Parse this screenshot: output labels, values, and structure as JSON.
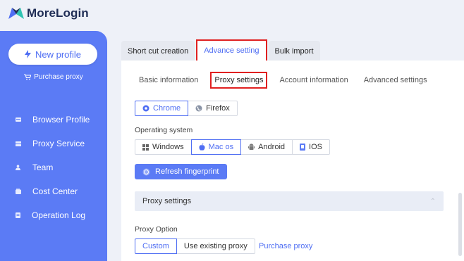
{
  "app": {
    "name": "MoreLogin"
  },
  "sidebar": {
    "new_profile_label": "New profile",
    "purchase_label": "Purchase proxy",
    "items": [
      {
        "label": "Browser Profile",
        "icon": "browser-icon"
      },
      {
        "label": "Proxy Service",
        "icon": "proxy-icon"
      },
      {
        "label": "Team",
        "icon": "team-icon"
      },
      {
        "label": "Cost Center",
        "icon": "wallet-icon"
      },
      {
        "label": "Operation Log",
        "icon": "log-icon"
      }
    ]
  },
  "main_tabs": [
    {
      "label": "Short cut creation",
      "active": false
    },
    {
      "label": "Advance setting",
      "active": true
    },
    {
      "label": "Bulk import",
      "active": false
    }
  ],
  "sub_tabs": [
    {
      "label": "Basic information",
      "active": false
    },
    {
      "label": "Proxy settings",
      "active": true
    },
    {
      "label": "Account information",
      "active": false
    },
    {
      "label": "Advanced settings",
      "active": false
    }
  ],
  "browser": {
    "options": [
      "Chrome",
      "Firefox"
    ],
    "selected": "Chrome"
  },
  "os": {
    "label": "Operating system",
    "options": [
      "Windows",
      "Mac os",
      "Android",
      "IOS"
    ],
    "selected": "Mac os"
  },
  "refresh_label": "Refresh fingerprint",
  "proxy_section": {
    "title": "Proxy settings"
  },
  "proxy_option": {
    "label": "Proxy Option",
    "options": [
      "Custom",
      "Use existing proxy"
    ],
    "selected": "Custom",
    "purchase_link": "Purchase proxy"
  },
  "colors": {
    "accent": "#4f6ef3",
    "sidebar": "#5b7bf5",
    "highlight": "#e02020"
  }
}
